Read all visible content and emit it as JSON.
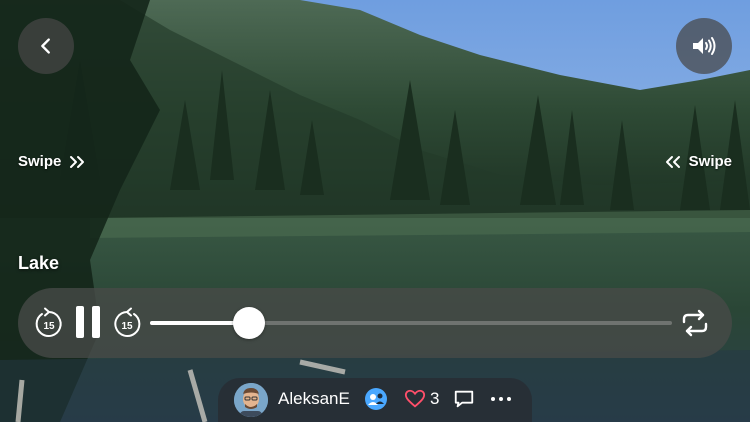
{
  "navigation": {
    "back_icon": "chevron-left-icon",
    "sound_icon": "speaker-wave-icon"
  },
  "hints": {
    "swipe_left_label": "Swipe",
    "swipe_right_label": "Swipe"
  },
  "media": {
    "title": "Lake"
  },
  "player": {
    "rewind_seconds": "15",
    "forward_seconds": "15",
    "state_icon": "pause-icon",
    "progress_fraction": 0.19,
    "repeat_icon": "repeat-icon"
  },
  "post": {
    "username": "AleksanE",
    "likes_count": "3",
    "liked_color": "#ff4f6a",
    "badge_color": "#4aa8ff"
  }
}
